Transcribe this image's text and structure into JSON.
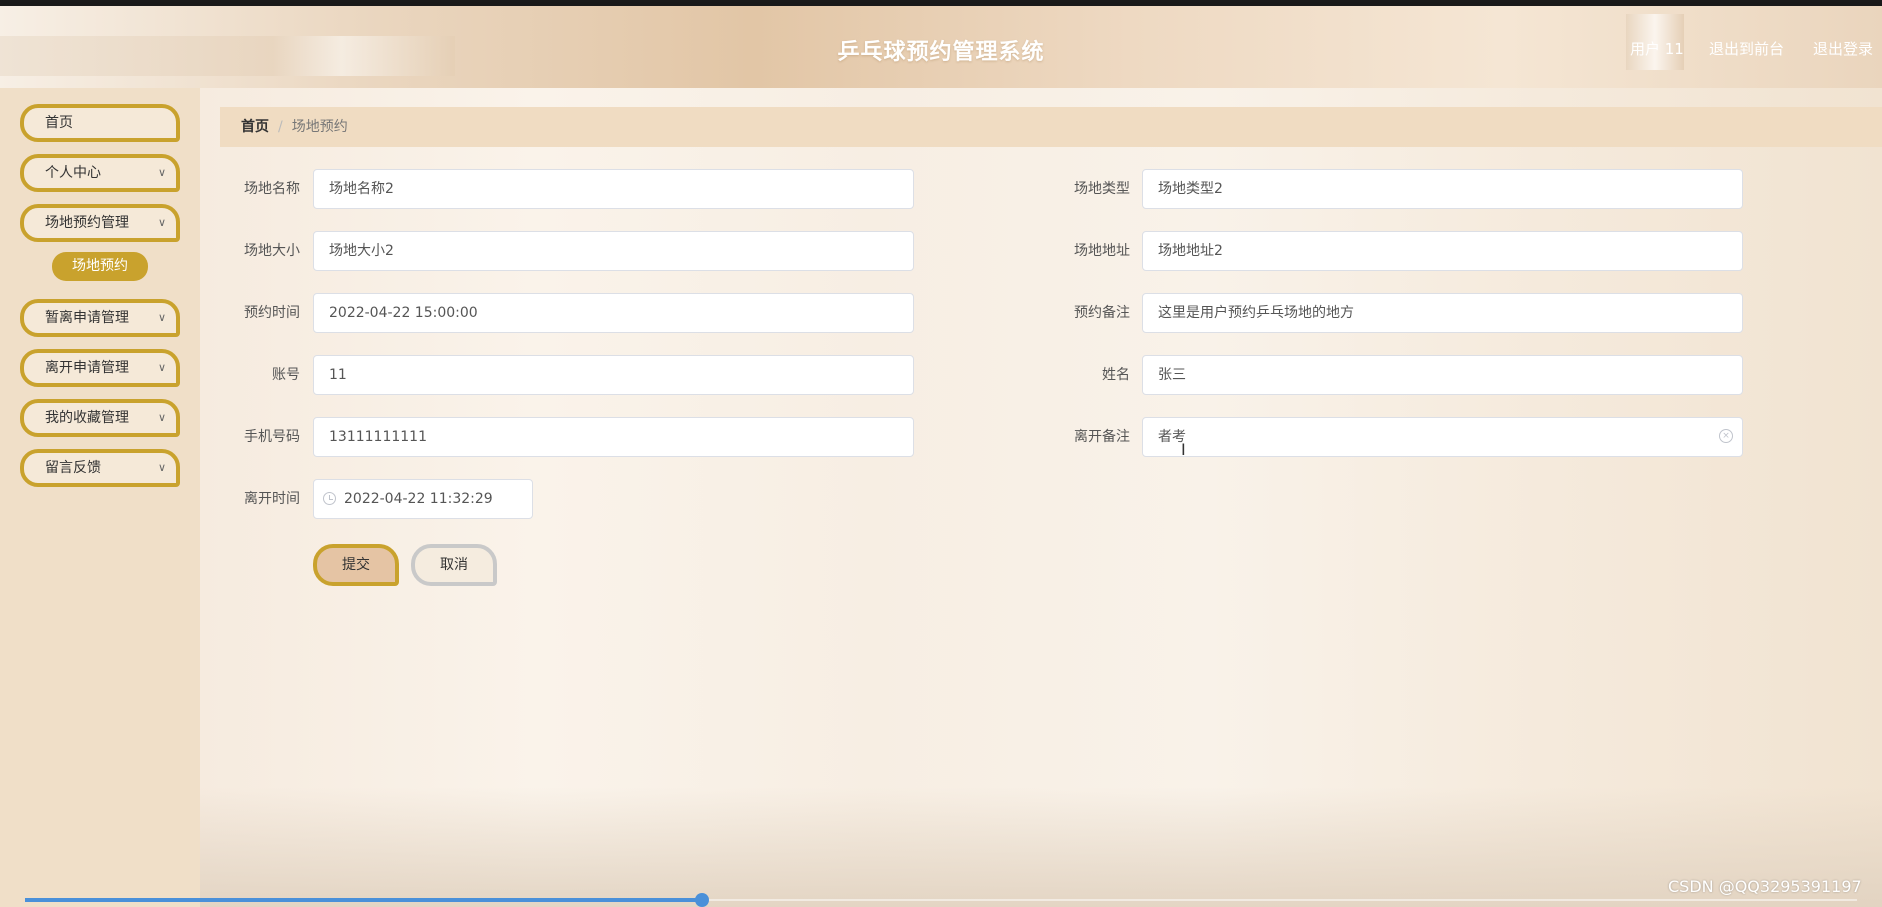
{
  "header": {
    "title": "乒乓球预约管理系统",
    "user": "用户 11",
    "back_to_front": "退出到前台",
    "logout": "退出登录"
  },
  "sidebar": {
    "home": "首页",
    "personal": "个人中心",
    "venue_booking": "场地预约管理",
    "venue_booking_sub": "场地预约",
    "temp_leave": "暂离申请管理",
    "leave": "离开申请管理",
    "favorites": "我的收藏管理",
    "feedback": "留言反馈"
  },
  "breadcrumb": {
    "home": "首页",
    "separator": "/",
    "current": "场地预约"
  },
  "form": {
    "venue_name": {
      "label": "场地名称",
      "value": "场地名称2"
    },
    "venue_type": {
      "label": "场地类型",
      "value": "场地类型2"
    },
    "venue_size": {
      "label": "场地大小",
      "value": "场地大小2"
    },
    "venue_address": {
      "label": "场地地址",
      "value": "场地地址2"
    },
    "booking_time": {
      "label": "预约时间",
      "value": "2022-04-22 15:00:00"
    },
    "booking_note": {
      "label": "预约备注",
      "value": "这里是用户预约乒乓场地的地方"
    },
    "account": {
      "label": "账号",
      "value": "11"
    },
    "name": {
      "label": "姓名",
      "value": "张三"
    },
    "phone": {
      "label": "手机号码",
      "value": "13111111111"
    },
    "leave_note": {
      "label": "离开备注",
      "value": "者考"
    },
    "leave_time": {
      "label": "离开时间",
      "value": "2022-04-22 11:32:29"
    },
    "submit": "提交",
    "cancel": "取消"
  },
  "watermark": "CSDN @QQ3295391197",
  "video_progress": 0.37,
  "colors": {
    "accent_gold": "#c9a22d",
    "sidebar_bg": "#f0dfc8",
    "breadcrumb_bg": "#f0dcc2",
    "progress_blue": "#4a90d9"
  }
}
